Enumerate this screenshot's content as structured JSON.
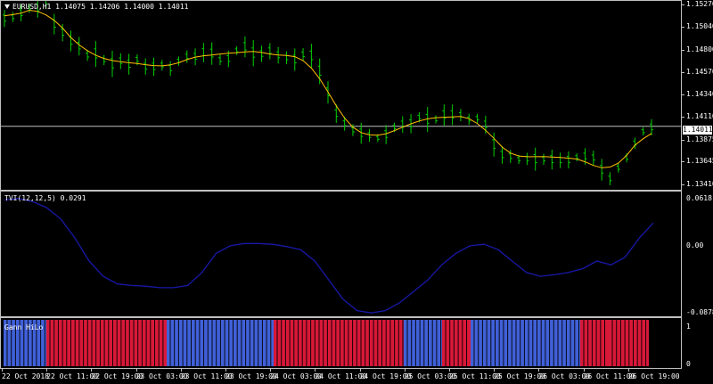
{
  "main_panel": {
    "header": "EURUSD,H1  1.14075 1.14206 1.14000 1.14011",
    "current_price": "1.14011",
    "y_ticks": [
      "1.15270",
      "1.15040",
      "1.14800",
      "1.14570",
      "1.14340",
      "1.14110",
      "1.13875",
      "1.13645",
      "1.13410"
    ],
    "colors": {
      "candles": "#00d000",
      "ma": "#ffc000",
      "price_line": "#c0c0c0"
    }
  },
  "tvi_panel": {
    "header": "TVI(12,12,5) 0.0291",
    "y_ticks": [
      "0.0618",
      "0.00",
      "-0.0878"
    ],
    "colors": {
      "line": "#1818a8"
    }
  },
  "gann_panel": {
    "header": "Gann HiLo",
    "y_ticks": [
      "1",
      "0"
    ],
    "colors": {
      "up": "#4060d8",
      "down": "#d81838"
    }
  },
  "time_axis": [
    "22 Oct 2018",
    "22 Oct 11:00",
    "22 Oct 19:00",
    "23 Oct 03:00",
    "23 Oct 11:00",
    "23 Oct 19:00",
    "24 Oct 03:00",
    "24 Oct 11:00",
    "24 Oct 19:00",
    "25 Oct 03:00",
    "25 Oct 11:00",
    "25 Oct 19:00",
    "26 Oct 03:00",
    "26 Oct 11:00",
    "26 Oct 19:00"
  ],
  "chart_data": [
    {
      "type": "line",
      "title": "EURUSD,H1",
      "ylim": [
        1.1341,
        1.1527
      ],
      "series": [
        {
          "name": "EURUSD,H1",
          "values": [
            1.1512,
            1.1516,
            1.1518,
            1.152,
            1.1524,
            1.1527,
            1.151,
            1.15,
            1.1492,
            1.1484,
            1.1478,
            1.1472,
            1.147,
            1.1468,
            1.1468,
            1.1467,
            1.1466,
            1.1465,
            1.1464,
            1.1462,
            1.1462,
            1.1465,
            1.147,
            1.1475,
            1.1478,
            1.1475,
            1.1472,
            1.1474,
            1.148,
            1.1482,
            1.1478,
            1.1476,
            1.1476,
            1.1475,
            1.1474,
            1.1473,
            1.1473,
            1.147,
            1.1455,
            1.1435,
            1.1418,
            1.1405,
            1.1398,
            1.1392,
            1.1388,
            1.139,
            1.1393,
            1.1396,
            1.14,
            1.1404,
            1.1408,
            1.141,
            1.1411,
            1.1411,
            1.141,
            1.141,
            1.1412,
            1.1413,
            1.14,
            1.1385,
            1.1375,
            1.137,
            1.1368,
            1.1369,
            1.137,
            1.1371,
            1.137,
            1.1369,
            1.1367,
            1.1367,
            1.1368,
            1.1365,
            1.1355,
            1.1348,
            1.1355,
            1.1372,
            1.1385,
            1.1395,
            1.1401
          ]
        }
      ]
    },
    {
      "type": "line",
      "title": "TVI(12,12,5) 0.0291",
      "ylim": [
        -0.0878,
        0.0618
      ],
      "series": [
        {
          "name": "TVI(12,12,5)",
          "values": [
            0.06,
            0.062,
            0.058,
            0.05,
            0.035,
            0.01,
            -0.02,
            -0.04,
            -0.05,
            -0.052,
            -0.053,
            -0.055,
            -0.055,
            -0.052,
            -0.035,
            -0.01,
            0.0,
            0.003,
            0.003,
            0.002,
            -0.001,
            -0.005,
            -0.02,
            -0.045,
            -0.07,
            -0.085,
            -0.088,
            -0.085,
            -0.075,
            -0.06,
            -0.045,
            -0.025,
            -0.01,
            0.0,
            0.002,
            -0.005,
            -0.02,
            -0.035,
            -0.04,
            -0.038,
            -0.035,
            -0.03,
            -0.02,
            -0.025,
            -0.015,
            0.01,
            0.03
          ]
        }
      ]
    },
    {
      "type": "bar",
      "title": "Gann HiLo",
      "ylim": [
        0,
        1
      ],
      "categories": [
        "22 Oct 2018",
        "22 Oct 11:00",
        "23 Oct 03:00",
        "24 Oct 03:00",
        "25 Oct 03:00",
        "25 Oct 11:00",
        "25 Oct 19:00",
        "26 Oct 03:00",
        "26 Oct 11:00",
        "26 Oct 19:00"
      ],
      "series": [
        {
          "name": "up",
          "values": [
            1,
            0,
            1,
            0,
            1,
            0,
            1,
            0,
            0,
            1
          ]
        },
        {
          "name": "down",
          "values": [
            0,
            1,
            0,
            1,
            0,
            1,
            0,
            1,
            1,
            0
          ]
        }
      ]
    }
  ]
}
